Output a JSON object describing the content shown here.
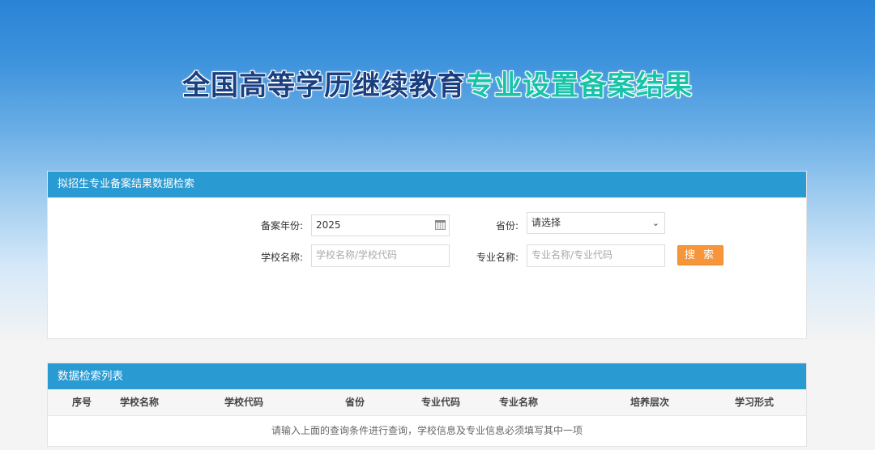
{
  "banner": {
    "title_part1": "全国高等学历继续教育",
    "title_part2": "专业设置备案结果"
  },
  "search_panel": {
    "heading": "拟招生专业备案结果数据检索",
    "year_label": "备案年份:",
    "year_value": "2025",
    "province_label": "省份:",
    "province_value": "请选择",
    "school_label": "学校名称:",
    "school_placeholder": "学校名称/学校代码",
    "major_label": "专业名称:",
    "major_placeholder": "专业名称/专业代码",
    "search_button": "搜 索"
  },
  "list_panel": {
    "heading": "数据检索列表",
    "columns": [
      "序号",
      "学校名称",
      "学校代码",
      "省份",
      "专业代码",
      "专业名称",
      "培养层次",
      "学习形式"
    ],
    "empty_message": "请输入上面的查询条件进行查询，学校信息及专业信息必须填写其中一项"
  },
  "icons": {
    "calendar": "calendar-icon",
    "dropdown": "chevron-down-icon"
  },
  "colors": {
    "header_blue": "#2a9ad2",
    "search_orange": "#f7953a",
    "title_dark": "#1a3f80",
    "title_teal": "#19c3a8"
  }
}
